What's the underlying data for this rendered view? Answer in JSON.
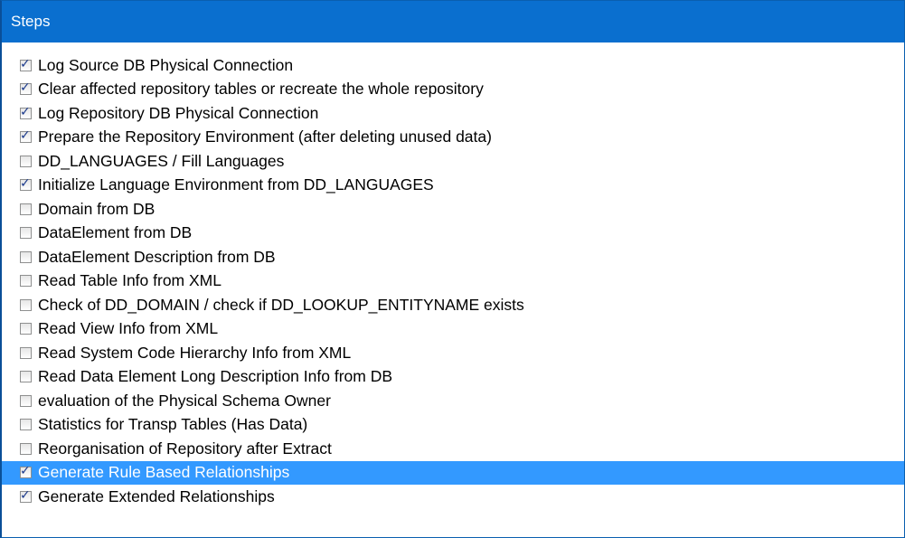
{
  "header": {
    "title": "Steps"
  },
  "steps": [
    {
      "label": "Log Source DB Physical Connection",
      "checked": true
    },
    {
      "label": "Clear affected repository tables or recreate the whole repository",
      "checked": true
    },
    {
      "label": "Log Repository DB Physical Connection",
      "checked": true
    },
    {
      "label": "Prepare the Repository Environment (after deleting unused data)",
      "checked": true
    },
    {
      "label": "DD_LANGUAGES / Fill Languages",
      "checked": false
    },
    {
      "label": "Initialize Language Environment from DD_LANGUAGES",
      "checked": true
    },
    {
      "label": "Domain from DB",
      "checked": false
    },
    {
      "label": "DataElement from DB",
      "checked": false
    },
    {
      "label": "DataElement Description from DB",
      "checked": false
    },
    {
      "label": "Read Table Info from XML",
      "checked": false
    },
    {
      "label": "Check of DD_DOMAIN / check if DD_LOOKUP_ENTITYNAME exists",
      "checked": false
    },
    {
      "label": "Read View Info from XML",
      "checked": false
    },
    {
      "label": "Read System Code Hierarchy Info from XML",
      "checked": false
    },
    {
      "label": "Read Data Element Long Description Info from DB",
      "checked": false
    },
    {
      "label": "evaluation of the Physical Schema Owner",
      "checked": false
    },
    {
      "label": "Statistics for Transp Tables (Has Data)",
      "checked": false
    },
    {
      "label": "Reorganisation of Repository after Extract",
      "checked": false
    },
    {
      "label": "Generate Rule Based Relationships",
      "checked": true,
      "selected": true
    },
    {
      "label": "Generate Extended Relationships",
      "checked": true
    }
  ],
  "colors": {
    "header_bg": "#0a6fcf",
    "selected_bg": "#3399ff",
    "check_mark": "#1b3a8c"
  },
  "icons": {
    "check": "checkmark-icon"
  }
}
